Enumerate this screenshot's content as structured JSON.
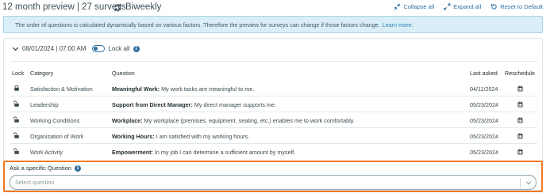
{
  "header": {
    "title": "12 month preview | 27 surveys",
    "frequency": "Biweekly",
    "actions": {
      "collapse_all": "Collapse all",
      "expand_all": "Expand all",
      "reset_default": "Reset to Default"
    }
  },
  "info": {
    "message": "The order of questions is calculated dynamically based on various factors. Therefore the preview for surveys can change if those factors change.",
    "learn_more": "Learn more."
  },
  "survey": {
    "date": "08/01/2024 | 07:00 AM",
    "lock_all_label": "Lock all",
    "lock_all_on": false
  },
  "table": {
    "columns": {
      "lock": "Lock",
      "category": "Category",
      "question": "Question",
      "last_asked": "Last asked",
      "reschedule": "Reschedule"
    },
    "rows": [
      {
        "locked": true,
        "category": "Satisfaction & Motivation",
        "q_title": "Meaningful Work:",
        "q_text": " My work tasks are meaningful to me.",
        "last_asked": "04/11/2024"
      },
      {
        "locked": false,
        "category": "Leadership",
        "q_title": "Support from Direct Manager:",
        "q_text": " My direct manager supports me.",
        "last_asked": "05/23/2024"
      },
      {
        "locked": false,
        "category": "Working Conditions",
        "q_title": "Workplace:",
        "q_text": " My workplace (premises, equipment, seating, etc.) enables me to work comfortably.",
        "last_asked": "05/23/2024"
      },
      {
        "locked": false,
        "category": "Organization of Work",
        "q_title": "Working Hours:",
        "q_text": " I am satisfied with my working hours.",
        "last_asked": "05/23/2024"
      },
      {
        "locked": false,
        "category": "Work Activity",
        "q_title": "Empowerment:",
        "q_text": " In my job I can determine a sufficient amount by myself.",
        "last_asked": "05/23/2024"
      }
    ]
  },
  "ask": {
    "label": "Ask a specific Question",
    "placeholder": "Select question"
  },
  "colors": {
    "accent": "#2f6f9f",
    "highlight_border": "#f07a22",
    "info_bg": "#d9eef7"
  },
  "icons": {
    "refresh": "refresh-icon",
    "collapse": "collapse-icon",
    "expand": "expand-icon",
    "reset": "reset-icon",
    "lock": "lock-icon",
    "unlock": "unlock-icon",
    "calendar": "calendar-icon",
    "chevron": "chevron-down-icon",
    "info": "info-icon"
  }
}
